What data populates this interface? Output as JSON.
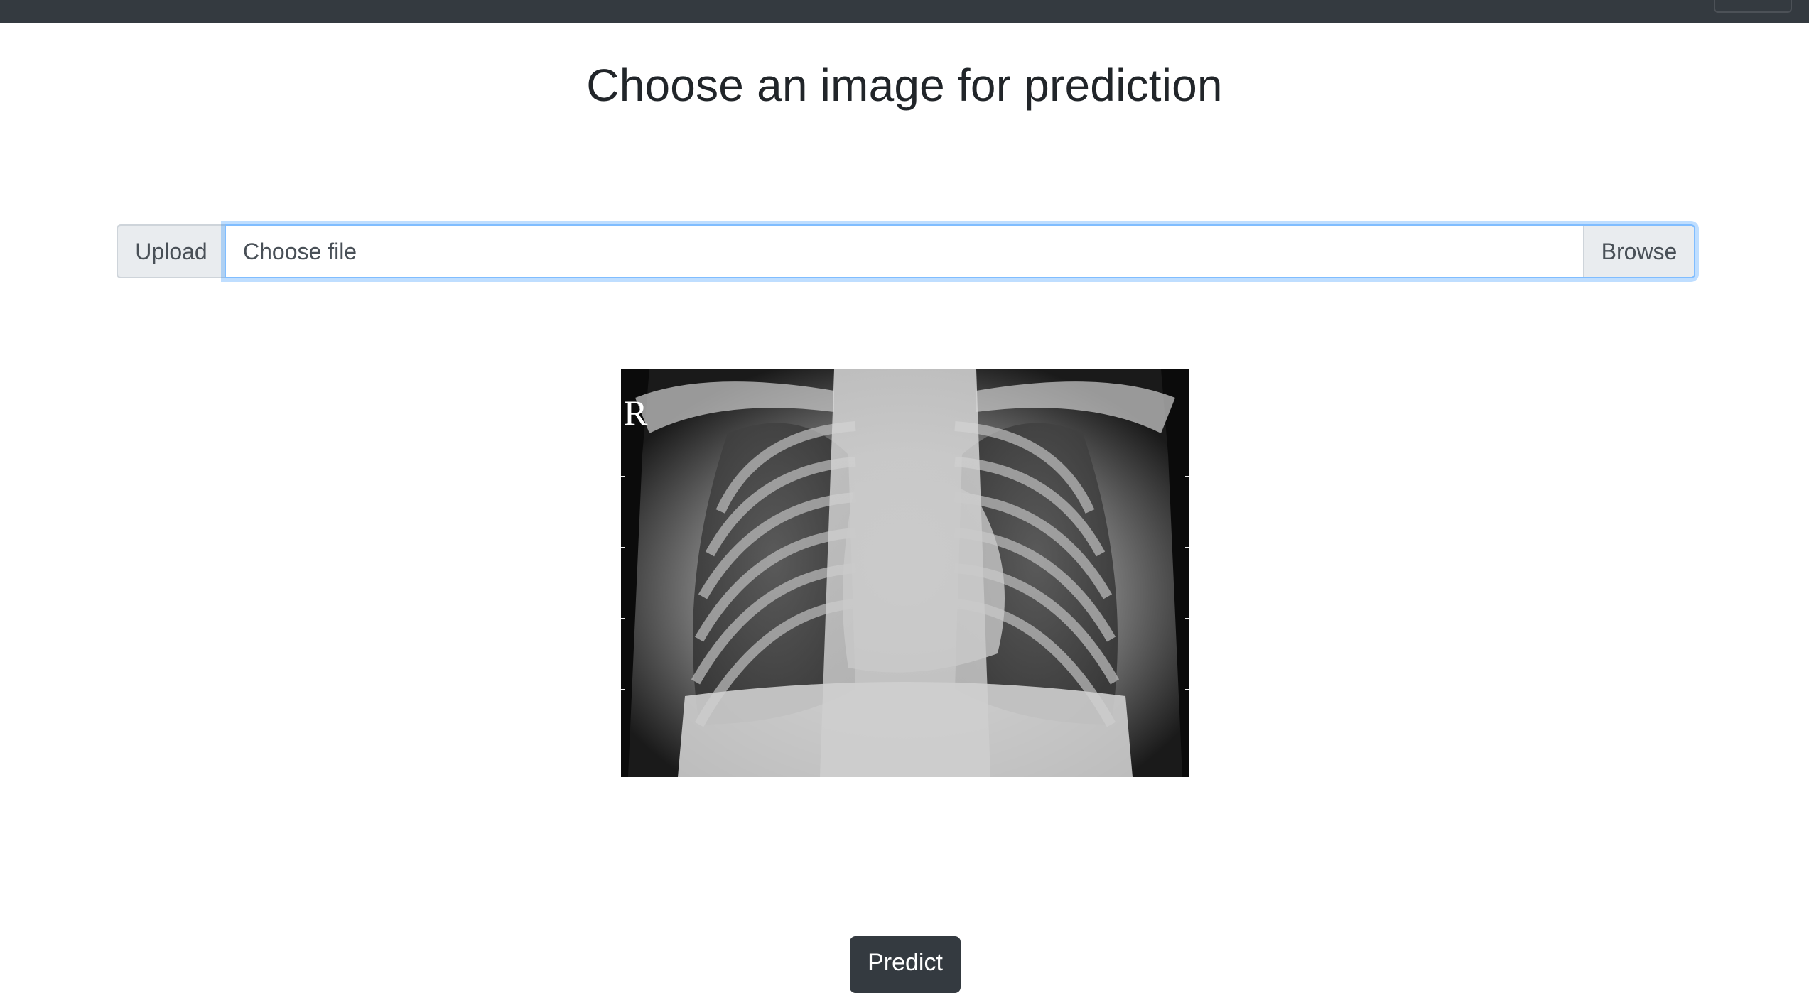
{
  "header": {
    "title": "Choose an image for prediction"
  },
  "upload": {
    "upload_label": "Upload",
    "file_placeholder": "Choose file",
    "browse_label": "Browse"
  },
  "preview": {
    "marker": "R"
  },
  "actions": {
    "predict_label": "Predict"
  },
  "colors": {
    "navbar": "#343a40",
    "focus_border": "#80bdff",
    "input_addon": "#e9ecef",
    "button_dark": "#343a40"
  }
}
